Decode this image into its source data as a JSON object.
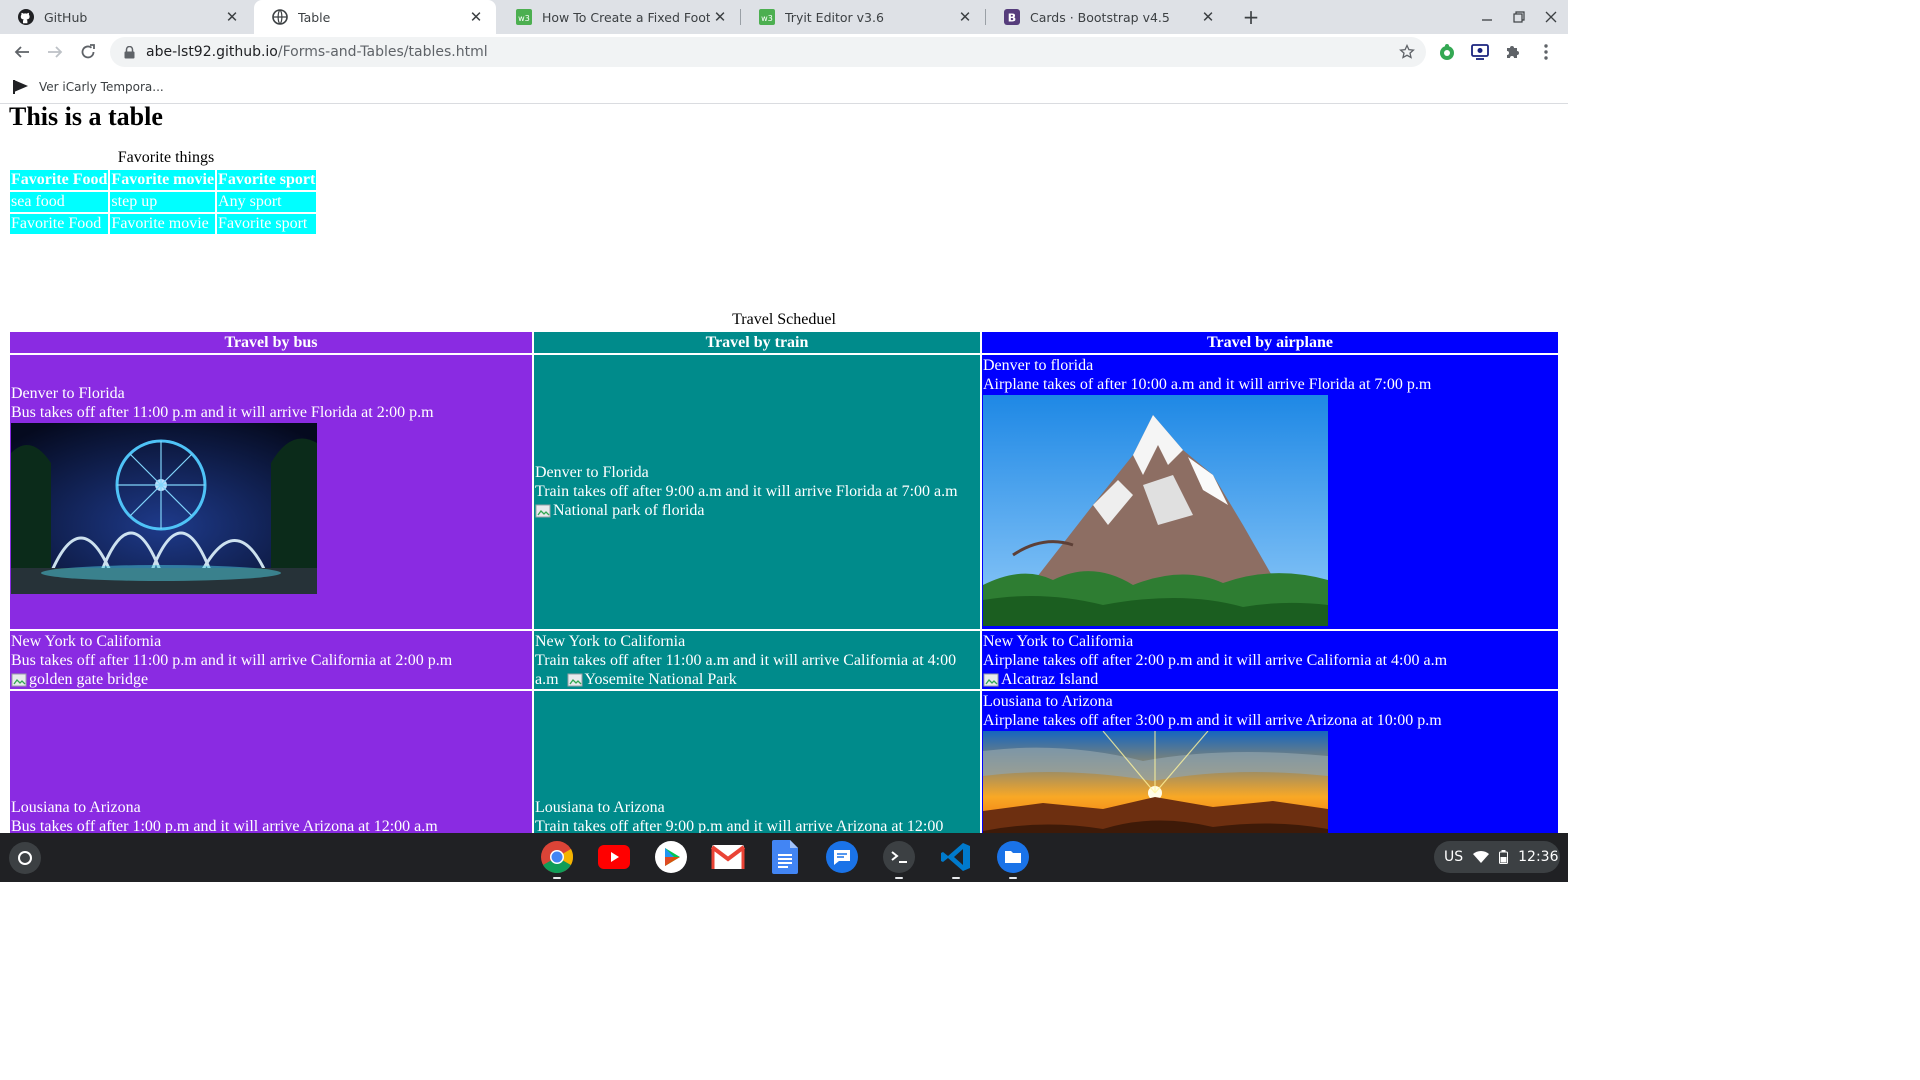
{
  "tabs": [
    {
      "title": "GitHub",
      "icon": "github-icon"
    },
    {
      "title": "Table",
      "icon": "globe-icon",
      "active": true
    },
    {
      "title": "How To Create a Fixed Footer",
      "icon": "w3schools-icon"
    },
    {
      "title": "Tryit Editor v3.6",
      "icon": "w3schools-icon"
    },
    {
      "title": "Cards · Bootstrap v4.5",
      "icon": "bootstrap-icon"
    }
  ],
  "tab_close_glyph": "✕",
  "new_tab_glyph": "+",
  "address_bar": {
    "domain": "abe-lst92.github.io",
    "path": "/Forms-and-Tables/tables.html"
  },
  "bookmarks": [
    {
      "label": "Ver iCarly Tempora..."
    }
  ],
  "page": {
    "heading": "This is a table",
    "favorites": {
      "caption": "Favorite things",
      "headers": [
        "Favorite Food",
        "Favorite movie",
        "Favorite sport"
      ],
      "rows": [
        [
          "sea food",
          "step up",
          "Any sport"
        ],
        [
          "Favorite Food",
          "Favorite movie",
          "Favorite sport"
        ]
      ]
    },
    "travel": {
      "caption": "Travel Scheduel",
      "headers": [
        "Travel by bus",
        "Travel by train",
        "Travel by airplane"
      ],
      "rows": [
        {
          "bus": {
            "route": "Denver to Florida",
            "text": "Bus takes off after 11:00 p.m and it will arrive Florida at 2:00 p.m",
            "image_alt": "Orlando Eye fountain at night"
          },
          "train": {
            "route": "Denver to Florida",
            "text": "Train takes off after 9:00 a.m and it will arrive Florida at 7:00 a.m",
            "broken_image_alt": "National park of florida"
          },
          "air": {
            "route": "Denver to florida",
            "text": "Airplane takes of after 10:00 a.m and it will arrive Florida at 7:00 p.m",
            "image_alt": "Snowy mountain"
          }
        },
        {
          "bus": {
            "route": "New York to California",
            "text": "Bus takes off after 11:00 p.m and it will arrive California at 2:00 p.m",
            "broken_image_alt": "golden gate bridge"
          },
          "train": {
            "route": "New York to California",
            "text_line1": "Train takes off after 11:00 a.m and it will arrive California at 4:00",
            "text_line2": "a.m",
            "broken_image_alt": "Yosemite National Park"
          },
          "air": {
            "route": "New York to California",
            "text": "Airplane takes off after 2:00 p.m and it will arrive California at 4:00 a.m",
            "broken_image_alt": "Alcatraz Island"
          }
        },
        {
          "bus": {
            "route": "Lousiana to Arizona",
            "text": "Bus takes off after 1:00 p.m and it will arrive Arizona at 12:00 a.m"
          },
          "train": {
            "route": "Lousiana to Arizona",
            "text": "Train takes off after 9:00 p.m and it will arrive Arizona at 12:00"
          },
          "air": {
            "route": "Lousiana to Arizona",
            "text": "Airplane takes off after 3:00 p.m and it will arrive Arizona at 10:00 p.m",
            "image_alt": "Canyon sunset"
          }
        }
      ]
    }
  },
  "shelf": {
    "apps": [
      "chrome-icon",
      "youtube-icon",
      "play-store-icon",
      "gmail-icon",
      "docs-icon",
      "messages-icon",
      "terminal-icon",
      "vscode-icon",
      "files-icon"
    ],
    "tray": {
      "input_method": "US",
      "time": "12:36"
    }
  },
  "colors": {
    "cyan": "#00ffff",
    "bus": "#8a2be2",
    "train": "#008b8b",
    "air": "#0000ff"
  }
}
